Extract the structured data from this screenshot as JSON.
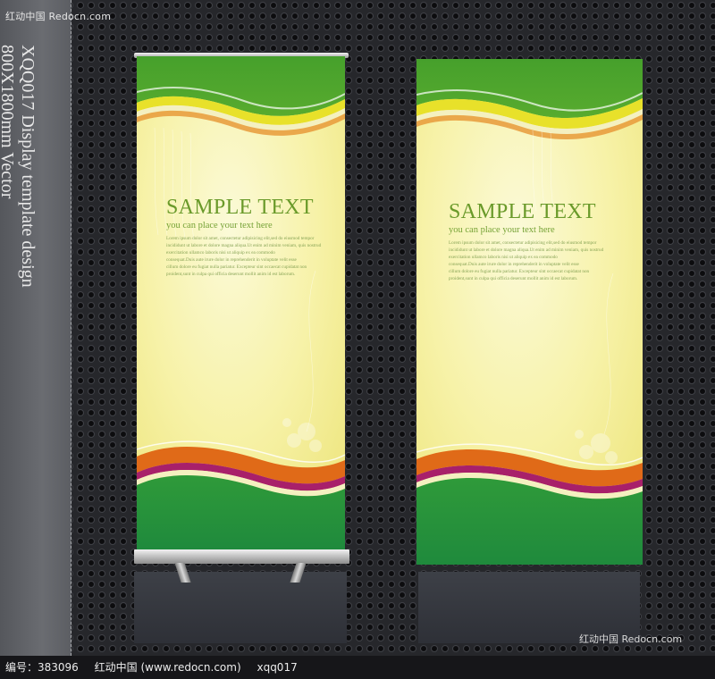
{
  "site_logo": "红动中国 Redocn.com",
  "caption": {
    "line1": "XQQ017 Display template design",
    "line2": "800X1800mm Vector"
  },
  "banner_left": {
    "title": "SAMPLE TEXT",
    "subtitle": "you can place your text here",
    "body_lines": [
      "Lorem ipsum dolor sit amet, consectetur adipisicing elit,sed do eiusmod tempor",
      "incididunt ut labore et dolore magna aliqua.Ut enim ad minim veniam, quis nostrud",
      "exercitation ullamco laboris nisi ut aliquip ex ea commodo",
      "consequat.Duis aute irure dolor in reprehenderit in voluptate velit esse",
      "cillum dolore eu fugiat nulla pariatur. Excepteur sint occaecat cupidatat non",
      "proident,sunt in culpa qui officia deserunt mollit anim id est laborum."
    ]
  },
  "banner_right": {
    "title": "SAMPLE TEXT",
    "subtitle": "you can place your text here",
    "body_lines": [
      "Lorem ipsum dolor sit amet, consectetur adipisicing elit,sed do eiusmod tempor",
      "incididunt ut labore et dolore magna aliqua.Ut enim ad minim veniam, quis nostrud",
      "exercitation ullamco laboris nisi ut aliquip ex ea commodo",
      "consequat.Duis aute irure dolor in reprehenderit in voluptate velit esse",
      "cillum dolore eu fugiat nulla pariatur. Excepteur sint occaecat cupidatat non",
      "proident,sunt in culpa qui officia deserunt mollit anim id est laborum."
    ]
  },
  "watermark": "红动中国 Redocn.com",
  "footer": {
    "id_label": "编号：383096",
    "site": "红动中国 (www.redocn.com)",
    "author": "xqq017"
  },
  "colors": {
    "banner_green": "#3f9c2b",
    "banner_dark_green": "#1f8a3c",
    "banner_yellow": "#f6f2a6",
    "accent_yellow": "#e8e12a",
    "accent_orange": "#e06a18",
    "accent_magenta": "#a8206a",
    "title_green": "#6a9a2a"
  }
}
